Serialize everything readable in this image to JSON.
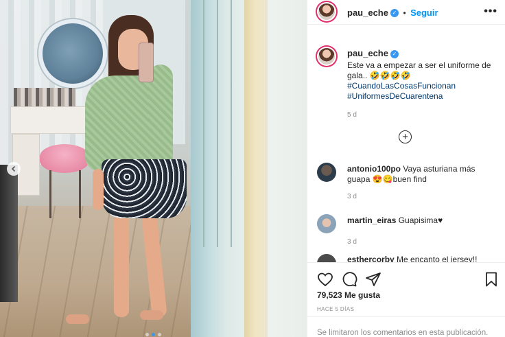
{
  "post": {
    "author": {
      "username": "pau_eche",
      "verified": true,
      "follow_label": "Seguir"
    },
    "more_label": "•••",
    "caption": {
      "text": "Este va a empezar a ser el uniforme de gala.. 🤣🤣🤣🤣",
      "hashtags": [
        "#CuandoLasCosasFuncionan",
        "#UniformesDeCuarentena"
      ],
      "time": "5 d"
    },
    "comments": [
      {
        "username": "antonio100po",
        "text": "Vaya asturiana más guapa 😍😋buen find",
        "time": "3 d"
      },
      {
        "username": "martin_eiras",
        "text": "Guapisima♥",
        "time": "3 d"
      },
      {
        "username": "esthercorby",
        "text": "Me encanto el jersey!!"
      }
    ],
    "likes": "79,523 Me gusta",
    "posted_ago": "HACE 5 DÍAS",
    "comments_disabled": "Se limitaron los comentarios en esta publicación."
  },
  "icons": {
    "verified": "verified-badge-icon",
    "more": "more-options-icon",
    "load_more": "plus-circle-icon",
    "like": "heart-icon",
    "comment": "comment-bubble-icon",
    "share": "paper-plane-icon",
    "save": "bookmark-icon",
    "prev": "chevron-left-icon"
  },
  "colors": {
    "link": "#0095f6",
    "hashtag": "#00376b",
    "muted": "#8e8e8e",
    "text": "#262626"
  }
}
